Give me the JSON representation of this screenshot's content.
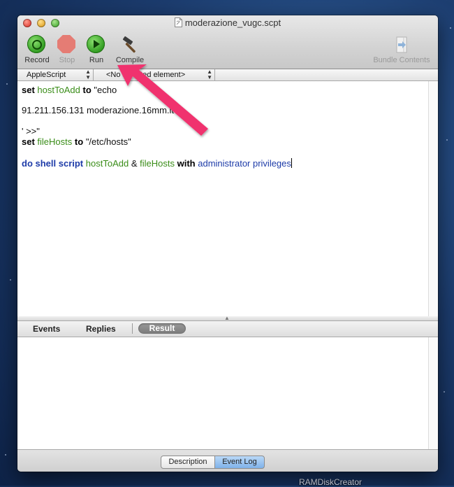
{
  "window": {
    "title": "moderazione_vugc.scpt",
    "doc_icon": "script-document-icon"
  },
  "toolbar": {
    "record_label": "Record",
    "stop_label": "Stop",
    "run_label": "Run",
    "compile_label": "Compile",
    "bundle_label": "Bundle Contents"
  },
  "navigation": {
    "language": "AppleScript",
    "element": "<No selected element>"
  },
  "script": {
    "line1": {
      "kw_set": "set",
      "var": "hostToAdd",
      "kw_to": "to",
      "str": "\"echo"
    },
    "line2": "91.211.156.131 moderazione.16mm.it",
    "line3": "' >>\"",
    "line4": {
      "kw_set": "set",
      "var": "fileHosts",
      "kw_to": "to",
      "str": "\"/etc/hosts\""
    },
    "line5": {
      "cmd": "do shell script",
      "var1": "hostToAdd",
      "amp": "&",
      "var2": "fileHosts",
      "kw_with": "with",
      "param": "administrator privileges"
    }
  },
  "result_tabs": {
    "events": "Events",
    "replies": "Replies",
    "result": "Result"
  },
  "bottom_tabs": {
    "description": "Description",
    "event_log": "Event Log"
  },
  "desktop": {
    "item_label": "RAMDiskCreator"
  },
  "annotation": {
    "arrow_color": "#f0326e"
  }
}
